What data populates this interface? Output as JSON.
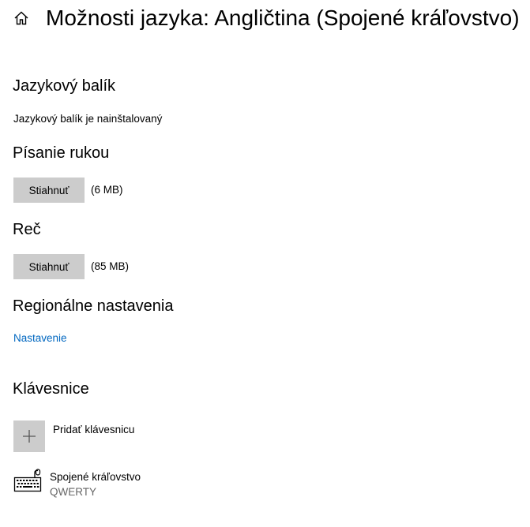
{
  "header": {
    "title": "Možnosti jazyka: Angličtina (Spojené kráľovstvo)",
    "home_icon": "home-icon"
  },
  "language_pack": {
    "heading": "Jazykový balík",
    "status": "Jazykový balík je nainštalovaný"
  },
  "handwriting": {
    "heading": "Písanie rukou",
    "button_label": "Stiahnuť",
    "size": "(6 MB)"
  },
  "speech": {
    "heading": "Reč",
    "button_label": "Stiahnuť",
    "size": "(85 MB)"
  },
  "regional": {
    "heading": "Regionálne nastavenia",
    "link_label": "Nastavenie",
    "link_color": "#0067c0"
  },
  "keyboards": {
    "heading": "Klávesnice",
    "add_label": "Pridať klávesnicu",
    "add_icon": "plus-icon",
    "items": [
      {
        "name": "Spojené kráľovstvo",
        "layout": "QWERTY",
        "icon": "keyboard-icon"
      }
    ]
  },
  "colors": {
    "button_bg": "#cccccc",
    "secondary_text": "#666666"
  }
}
